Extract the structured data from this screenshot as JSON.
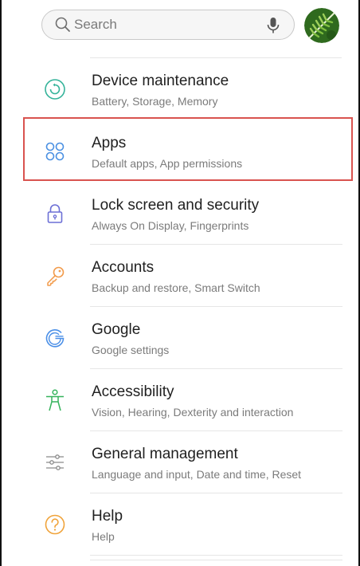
{
  "search": {
    "placeholder": "Search",
    "icon": "search-icon",
    "mic_icon": "mic-icon"
  },
  "items": [
    {
      "title": "Device maintenance",
      "subtitle": "Battery, Storage, Memory",
      "icon": "device-maintenance-icon",
      "color": "#35b39a"
    },
    {
      "title": "Apps",
      "subtitle": "Default apps, App permissions",
      "icon": "apps-icon",
      "color": "#4a90e2"
    },
    {
      "title": "Lock screen and security",
      "subtitle": "Always On Display, Fingerprints",
      "icon": "lock-icon",
      "color": "#6c6fd6"
    },
    {
      "title": "Accounts",
      "subtitle": "Backup and restore, Smart Switch",
      "icon": "key-icon",
      "color": "#f29b4b"
    },
    {
      "title": "Google",
      "subtitle": "Google settings",
      "icon": "google-icon",
      "color": "#4a8fe7"
    },
    {
      "title": "Accessibility",
      "subtitle": "Vision, Hearing, Dexterity and interaction",
      "icon": "accessibility-icon",
      "color": "#35b35c"
    },
    {
      "title": "General management",
      "subtitle": "Language and input, Date and time, Reset",
      "icon": "sliders-icon",
      "color": "#8a8a8a"
    },
    {
      "title": "Help",
      "subtitle": "Help",
      "icon": "help-icon",
      "color": "#f0a33a"
    }
  ],
  "highlight": {
    "color": "#d9534f",
    "item": "Apps"
  }
}
